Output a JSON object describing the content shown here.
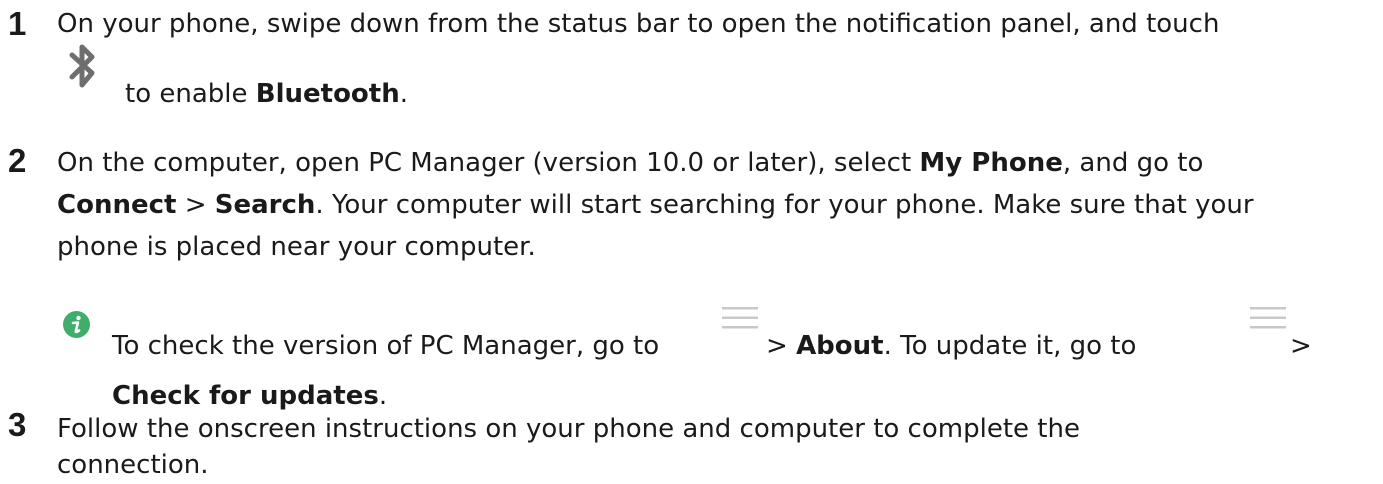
{
  "steps": [
    {
      "number": "1",
      "line1": "On your phone, swipe down from the status bar to open the notification panel, and touch",
      "line2_text": "to enable ",
      "line2_bold": "Bluetooth",
      "line2_end": ".",
      "icon": "bluetooth-icon"
    },
    {
      "number": "2",
      "line1_text": "On the computer, open PC Manager (version 10.0 or later), select ",
      "line1_bold": "My Phone",
      "line1_end": ", and go to",
      "line2_bold1": "Connect",
      "line2_sep": " > ",
      "line2_bold2": "Search",
      "line2_end": ". Your computer will start searching for your phone. Make sure that your",
      "line3": "phone is placed near your computer."
    },
    {
      "number": "3",
      "line1": "Follow the onscreen instructions on your phone and computer to complete the",
      "line2": "connection."
    }
  ],
  "note": {
    "icon": "info-icon",
    "line1_text": "To check the version of PC Manager, go to",
    "line1_sep1": " > ",
    "line1_bold1": "About",
    "line1_mid": ". To update it, go to",
    "line1_sep2": " >",
    "line2_bold": "Check for updates",
    "line2_end": ".",
    "menu_icon": "menu-icon"
  },
  "colors": {
    "text": "#1a1a1a",
    "info_icon": "#3fae6a",
    "icon_gray": "#6e6e6e",
    "menu_gray": "#c8c8c8"
  }
}
